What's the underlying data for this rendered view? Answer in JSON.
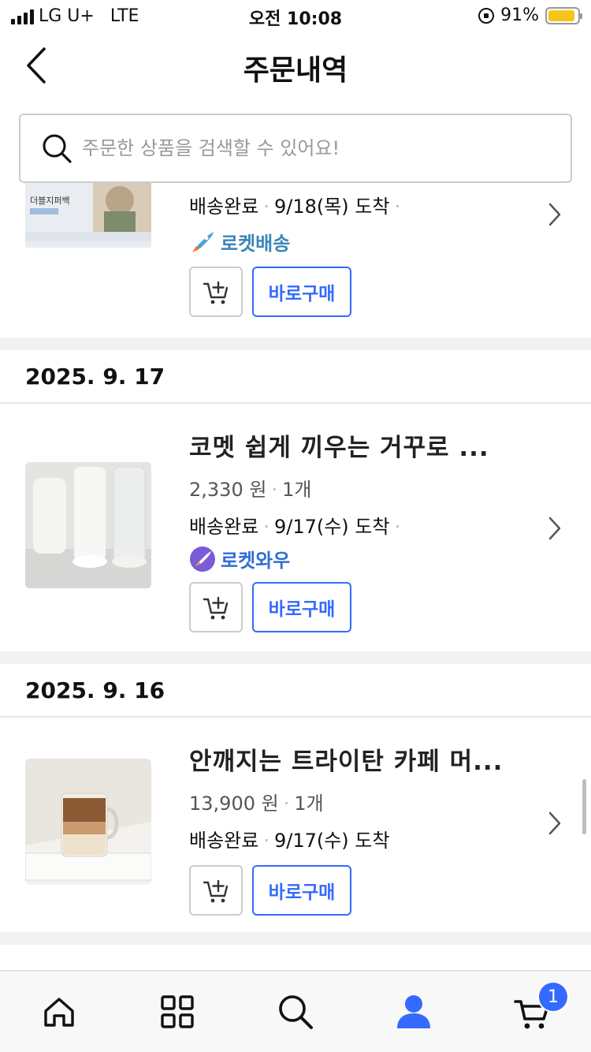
{
  "status_bar": {
    "carrier": "LG U+",
    "network": "LTE",
    "time": "오전 10:08",
    "battery": "91%",
    "battery_level": 0.91
  },
  "header": {
    "title": "주문내역"
  },
  "search": {
    "placeholder": "주문한 상품을 검색할 수 있어요!"
  },
  "orders_top": {
    "thumb_caption": "더블지퍼백",
    "status": "배송완료",
    "arrival": "9/18(목) 도착",
    "badge": "로켓배송",
    "buy_label": "바로구매"
  },
  "groups": [
    {
      "date": "2025. 9. 17",
      "title": "코멧 쉽게 끼우는 거꾸로 ...",
      "price": "2,330 원",
      "qty": "1개",
      "status": "배송완료",
      "arrival": "9/17(수) 도착",
      "badge": "로켓와우",
      "buy_label": "바로구매"
    },
    {
      "date": "2025. 9. 16",
      "title": "안깨지는 트라이탄 카페 머...",
      "price": "13,900 원",
      "qty": "1개",
      "status": "배송완료",
      "arrival": "9/17(수) 도착",
      "buy_label": "바로구매"
    }
  ],
  "tabbar": {
    "items": [
      "home-icon",
      "category-icon",
      "search-icon",
      "my-icon",
      "cart-icon"
    ],
    "cart_count": "1",
    "active": "my-icon"
  },
  "colors": {
    "accent": "#346aff",
    "rocket": "#3a86b6",
    "divider": "#f1f2f4"
  }
}
